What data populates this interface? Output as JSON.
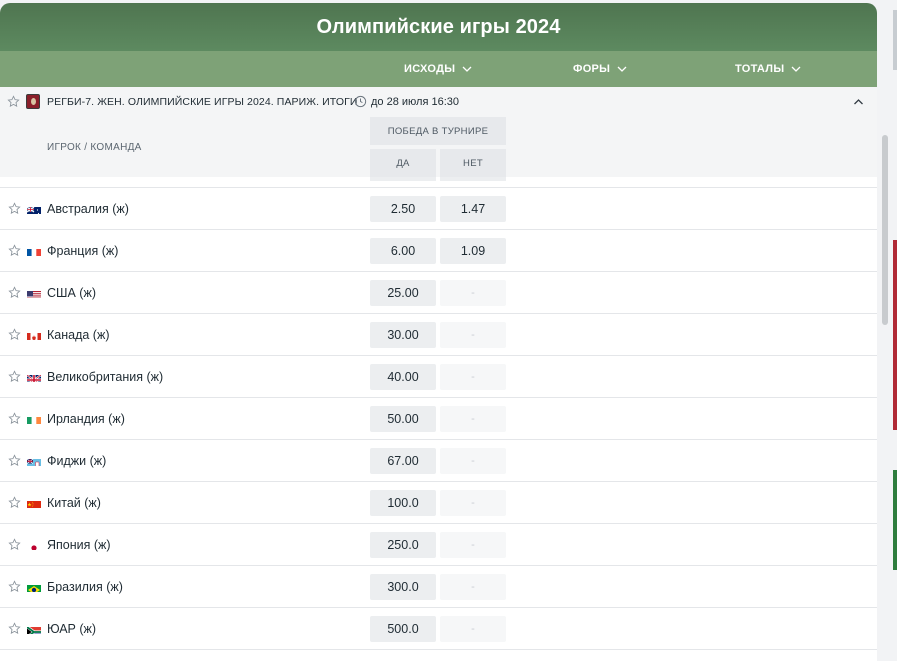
{
  "header": {
    "title": "Олимпийские игры 2024"
  },
  "market_tabs": [
    {
      "label": "ИСХОДЫ"
    },
    {
      "label": "ФОРЫ"
    },
    {
      "label": "ТОТАЛЫ"
    }
  ],
  "event": {
    "title": "РЕГБИ-7. ЖЕН. ОЛИМПИЙСКИЕ ИГРЫ 2024. ПАРИЖ. ИТОГИ",
    "time": "до 28 июля 16:30"
  },
  "columns": {
    "player": "ИГРОК / КОМАНДА",
    "group": "ПОБЕДА В ТУРНИРЕ",
    "yes": "ДА",
    "no": "НЕТ"
  },
  "colors": {
    "hero": "#5d8a60",
    "tabs": "#7ea277",
    "odd_bg": "#eceef0"
  },
  "rows": [
    {
      "name": "Австралия (ж)",
      "flag": "au",
      "yes": "2.50",
      "no": "1.47"
    },
    {
      "name": "Франция (ж)",
      "flag": "fr",
      "yes": "6.00",
      "no": "1.09"
    },
    {
      "name": "США (ж)",
      "flag": "us",
      "yes": "25.00",
      "no": "-"
    },
    {
      "name": "Канада (ж)",
      "flag": "ca",
      "yes": "30.00",
      "no": "-"
    },
    {
      "name": "Великобритания (ж)",
      "flag": "gb",
      "yes": "40.00",
      "no": "-"
    },
    {
      "name": "Ирландия (ж)",
      "flag": "ie",
      "yes": "50.00",
      "no": "-"
    },
    {
      "name": "Фиджи (ж)",
      "flag": "fj",
      "yes": "67.00",
      "no": "-"
    },
    {
      "name": "Китай (ж)",
      "flag": "cn",
      "yes": "100.0",
      "no": "-"
    },
    {
      "name": "Япония (ж)",
      "flag": "jp",
      "yes": "250.0",
      "no": "-"
    },
    {
      "name": "Бразилия (ж)",
      "flag": "br",
      "yes": "300.0",
      "no": "-"
    },
    {
      "name": "ЮАР (ж)",
      "flag": "za",
      "yes": "500.0",
      "no": "-"
    }
  ]
}
